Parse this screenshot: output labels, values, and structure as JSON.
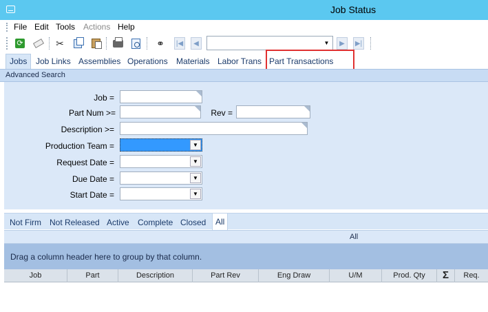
{
  "window": {
    "title": "Job Status"
  },
  "menu": [
    "File",
    "Edit",
    "Tools",
    "Actions",
    "Help"
  ],
  "toolbar": {
    "icons": [
      "refresh-icon",
      "eraser-icon",
      "cut-icon",
      "copy-icon",
      "paste-icon",
      "print-icon",
      "print-preview-icon",
      "binoculars-icon",
      "first-record-icon",
      "previous-record-icon",
      "next-record-icon",
      "last-record-icon"
    ],
    "nav_value": ""
  },
  "tabs": [
    "Jobs",
    "Job Links",
    "Assemblies",
    "Operations",
    "Materials",
    "Labor Trans",
    "Part Transactions"
  ],
  "active_tab": "Jobs",
  "advanced_search": {
    "label": "Advanced Search"
  },
  "form": {
    "job_label": "Job =",
    "job_value": "",
    "partnum_label": "Part Num >=",
    "partnum_value": "",
    "rev_label": "Rev =",
    "rev_value": "",
    "description_label": "Description >=",
    "description_value": "",
    "prod_team_label": "Production Team =",
    "prod_team_value": "",
    "request_date_label": "Request Date =",
    "request_date_value": "",
    "due_date_label": "Due Date =",
    "due_date_value": "",
    "start_date_label": "Start Date =",
    "start_date_value": ""
  },
  "filter_tabs": [
    "Not Firm",
    "Not Released",
    "Active",
    "Complete",
    "Closed",
    "All"
  ],
  "active_filter": "All",
  "grid": {
    "all_label": "All",
    "group_hint": "Drag a column header here to group by that column.",
    "columns": [
      "Job",
      "Part",
      "Description",
      "Part Rev",
      "Eng Draw",
      "U/M",
      "Prod. Qty",
      "Σ",
      "Req."
    ]
  },
  "colors": {
    "titlebar": "#5bc8f0",
    "highlight": "#e03030",
    "selection": "#3399ff"
  }
}
